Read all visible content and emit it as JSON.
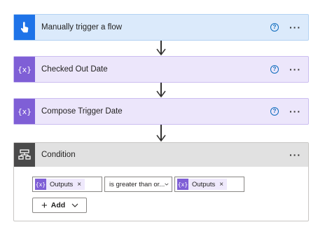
{
  "steps": [
    {
      "title": "Manually trigger a flow",
      "icon": "hand-touch-icon",
      "color": "#1e73e8"
    },
    {
      "title": "Checked Out Date",
      "icon": "compose-icon",
      "color": "#7f5fd6"
    },
    {
      "title": "Compose Trigger Date",
      "icon": "compose-icon",
      "color": "#7f5fd6"
    }
  ],
  "condition": {
    "title": "Condition",
    "left_token": "Outputs",
    "operator": "is greater than or...",
    "right_token": "Outputs",
    "add_label": "Add"
  },
  "labels": {
    "help": "?",
    "more": "···",
    "remove": "×"
  }
}
